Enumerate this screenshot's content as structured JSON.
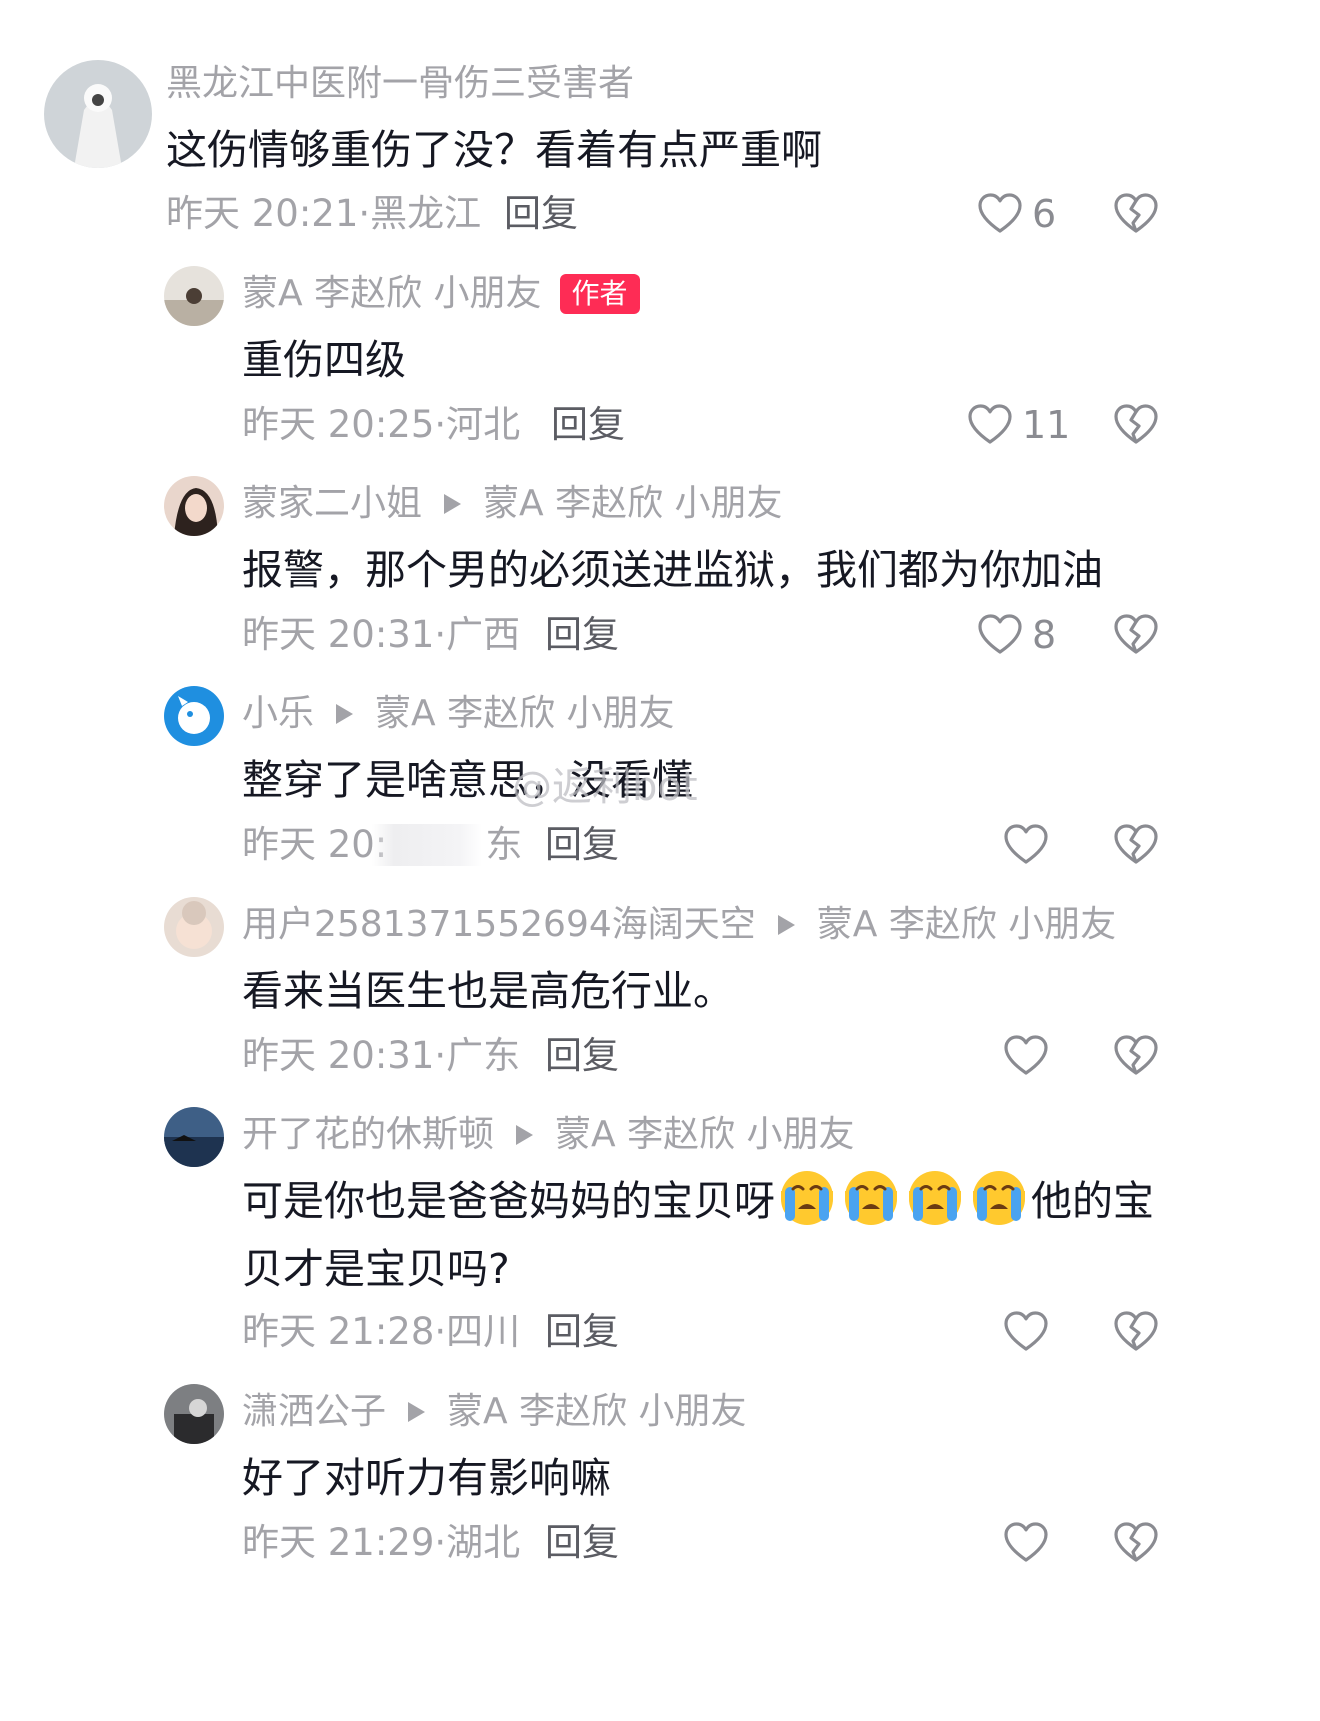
{
  "comments": [
    {
      "user": "黑龙江中医附一骨伤三受害者",
      "text": "这伤情够重伤了没？看着有点严重啊",
      "time": "昨天 20:21·",
      "region": "黑龙江",
      "reply": "回复",
      "likes": "6"
    },
    {
      "user": "蒙A 李赵欣 小朋友",
      "badge": "作者",
      "text": "重伤四级",
      "time": "昨天 20:25·",
      "region": "河北",
      "reply": "回复",
      "likes": "11"
    },
    {
      "user": "蒙家二小姐",
      "reply_to": "蒙A 李赵欣 小朋友",
      "text": "报警，那个男的必须送进监狱，我们都为你加油",
      "time": "昨天 20:31·",
      "region": "广西",
      "reply": "回复",
      "likes": "8"
    },
    {
      "user": "小乐",
      "reply_to": "蒙A 李赵欣 小朋友",
      "text": "整穿了是啥意思，没看懂",
      "time": "昨天 20:",
      "region": "东",
      "reply": "回复",
      "likes": ""
    },
    {
      "user": "用户2581371552694海阔天空",
      "reply_to": "蒙A 李赵欣 小朋友",
      "text": "看来当医生也是高危行业。",
      "time": "昨天 20:31·",
      "region": "广东",
      "reply": "回复",
      "likes": ""
    },
    {
      "user": "开了花的休斯顿",
      "reply_to": "蒙A 李赵欣 小朋友",
      "text_a": "可是你也是爸爸妈妈的宝贝呀",
      "text_b": "他的宝",
      "text_c": "贝才是宝贝吗?",
      "time": "昨天 21:28·",
      "region": "四川",
      "reply": "回复",
      "likes": ""
    },
    {
      "user": "潇洒公子",
      "reply_to": "蒙A 李赵欣 小朋友",
      "text": "好了对听力有影响嘛",
      "time": "昨天 21:29·",
      "region": "湖北",
      "reply": "回复",
      "likes": ""
    }
  ],
  "watermark": "@返利bot",
  "icons": {
    "like": "heart-outline-icon",
    "dislike": "broken-heart-icon",
    "emoji": "crying-face-emoji"
  },
  "colors": {
    "badge": "#fe2c55",
    "meta": "#a3a3a8",
    "text": "#161823"
  }
}
